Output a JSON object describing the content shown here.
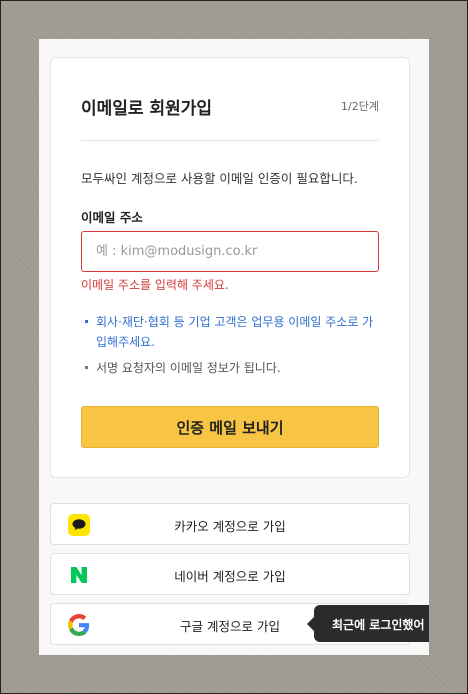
{
  "signup": {
    "title": "이메일로 회원가입",
    "step": "1/2단계",
    "description": "모두싸인 계정으로 사용할 이메일 인증이 필요합니다.",
    "email_label": "이메일 주소",
    "email_placeholder": "예 : kim@modusign.co.kr",
    "email_value": "",
    "error_message": "이메일 주소를 입력해 주세요.",
    "notes": [
      {
        "text": "회사·재단·협회 등 기업 고객은 업무용 이메일 주소로 가입해주세요.",
        "color": "#2f6fd0"
      },
      {
        "text": "서명 요청자의 이메일 정보가 됩니다.",
        "color": "#555555"
      }
    ],
    "submit_label": "인증 메일 보내기"
  },
  "social": [
    {
      "label": "카카오 계정으로 가입",
      "icon": "kakao-icon"
    },
    {
      "label": "네이버 계정으로 가입",
      "icon": "naver-icon"
    },
    {
      "label": "구글 계정으로 가입",
      "icon": "google-icon"
    }
  ],
  "tooltip": {
    "text": "최근에 로그인했어"
  },
  "colors": {
    "accent": "#f7c443",
    "error": "#d33a3a",
    "link": "#2f6fd0",
    "kakao": "#fee500",
    "naver": "#03c75a"
  }
}
